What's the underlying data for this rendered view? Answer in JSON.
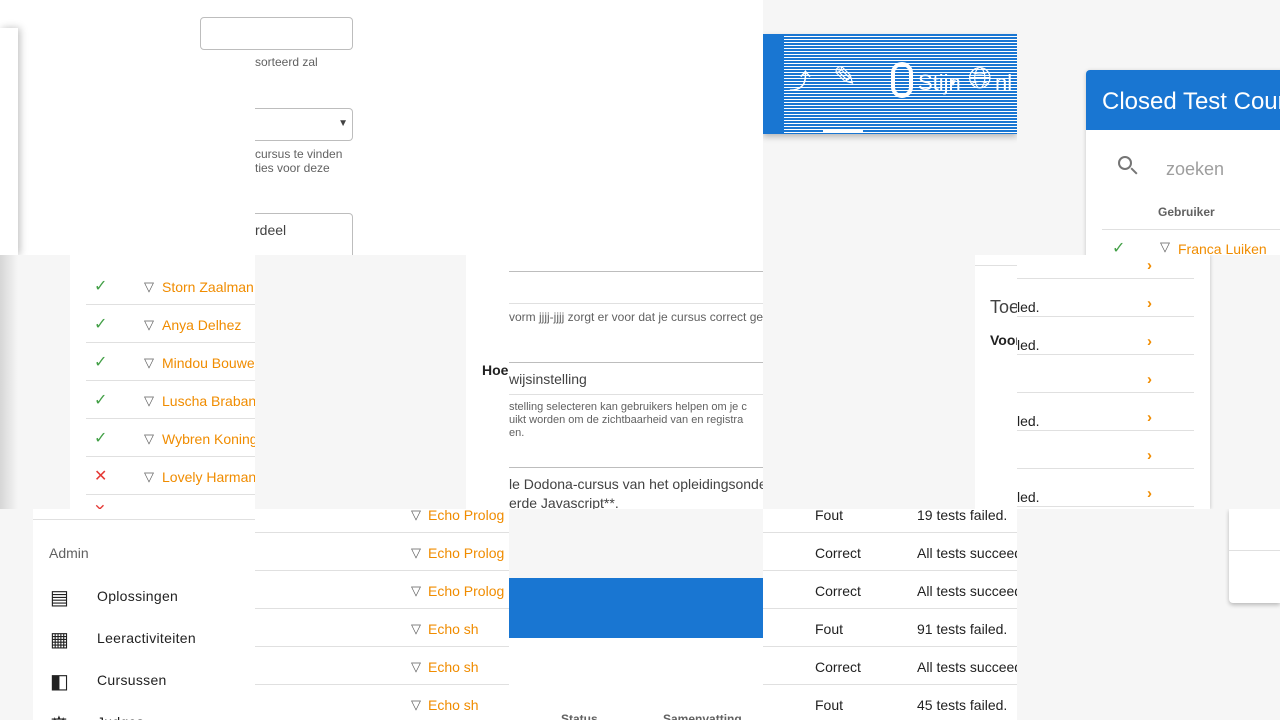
{
  "form_tile": {
    "sort_hint": "sorteerd zal",
    "help_lines": [
      "cursus te vinden",
      "ties voor deze"
    ],
    "textarea_text": "rdeel"
  },
  "toolbar": {
    "user_label": "Stijn",
    "lang_label": "nl"
  },
  "course_card": {
    "title": "Closed Test Cour",
    "search_placeholder": "zoeken",
    "column_user": "Gebruiker",
    "first_user": "Franca Luiken"
  },
  "left_list": {
    "rows": [
      {
        "status": "correct",
        "name": "Storn Zaalman"
      },
      {
        "status": "correct",
        "name": "Anya Delhez"
      },
      {
        "status": "correct",
        "name": "Mindou Bouwe"
      },
      {
        "status": "correct",
        "name": "Luscha Braban"
      },
      {
        "status": "correct",
        "name": "Wybren Koning"
      },
      {
        "status": "wrong",
        "name": "Lovely Harman"
      }
    ]
  },
  "middle_form": {
    "hint_year": "vorm jjjj-jjjj zorgt er voor dat je cursus correct ge",
    "label_how": "Hoe",
    "field_visibility": "wijsinstelling",
    "help_visibility": [
      "stelling selecteren kan gebruikers helpen om je c",
      "uikt worden om de zichtbaarheid van en registra",
      "en."
    ],
    "description_lines": [
      "le Dodona-cursus van het opleidingsonde",
      "erde Javascript**."
    ]
  },
  "right_panel": {
    "row_texts": [
      "",
      "led.",
      "led.",
      "",
      "led.",
      "",
      "led."
    ],
    "heading": "Toe",
    "subheading": "Voor"
  },
  "admin_menu": {
    "section_label": "Admin",
    "items": [
      {
        "icon": "file-document-icon",
        "label": "Oplossingen"
      },
      {
        "icon": "clipboard-text-icon",
        "label": "Leeractiviteiten"
      },
      {
        "icon": "book-multiple-icon",
        "label": "Cursussen"
      },
      {
        "icon": "judge-icon",
        "label": "Judges"
      }
    ]
  },
  "submissions": {
    "rows": [
      {
        "exercise": "Echo Prolog",
        "status": "Fout",
        "summary": "19 tests failed."
      },
      {
        "exercise": "Echo Prolog",
        "status": "Correct",
        "summary": "All tests succeed"
      },
      {
        "exercise": "Echo Prolog",
        "status": "Correct",
        "summary": "All tests succeed"
      },
      {
        "exercise": "Echo sh",
        "status": "Fout",
        "summary": "91 tests failed."
      },
      {
        "exercise": "Echo sh",
        "status": "Correct",
        "summary": "All tests succeed"
      },
      {
        "exercise": "Echo sh",
        "status": "Fout",
        "summary": "45 tests failed."
      }
    ]
  },
  "mini_table": {
    "col_status": "Status",
    "col_summary": "Samenvatting"
  },
  "colors": {
    "primary": "#1976d2",
    "accent": "#f08c00",
    "success": "#43a047",
    "error": "#e53935"
  }
}
